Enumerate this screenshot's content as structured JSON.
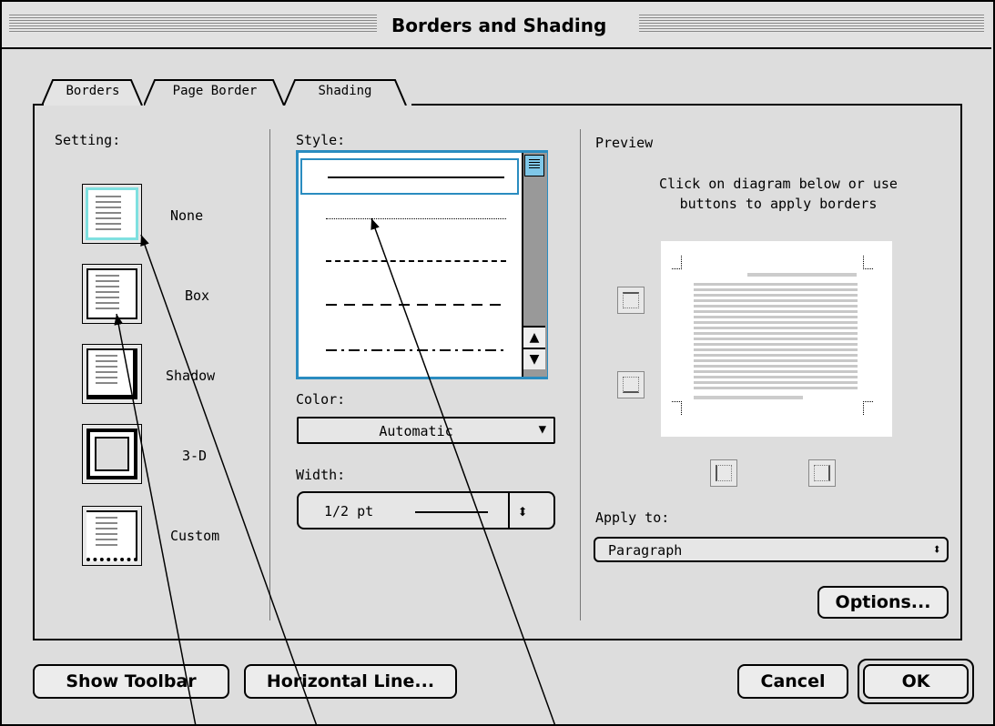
{
  "window": {
    "title": "Borders and Shading"
  },
  "tabs": [
    {
      "label": "Borders",
      "active": true
    },
    {
      "label": "Page Border",
      "active": false
    },
    {
      "label": "Shading",
      "active": false
    }
  ],
  "setting": {
    "heading": "Setting:",
    "options": [
      "None",
      "Box",
      "Shadow",
      "3-D",
      "Custom"
    ],
    "selected": "None"
  },
  "style": {
    "heading": "Style:",
    "options": [
      "solid",
      "dotted",
      "dashed-small",
      "dashed",
      "dash-dot"
    ],
    "selected": "solid"
  },
  "color": {
    "heading": "Color:",
    "value": "Automatic"
  },
  "width": {
    "heading": "Width:",
    "value": "1/2 pt"
  },
  "preview": {
    "heading": "Preview",
    "instructions": "Click on diagram below or use buttons to apply borders"
  },
  "apply_to": {
    "heading": "Apply to:",
    "value": "Paragraph"
  },
  "buttons": {
    "options": "Options...",
    "show_toolbar": "Show Toolbar",
    "horizontal_line": "Horizontal Line...",
    "cancel": "Cancel",
    "ok": "OK"
  },
  "colors": {
    "selection": "#2a8cc0",
    "selected_setting": "#7fe0e0"
  }
}
